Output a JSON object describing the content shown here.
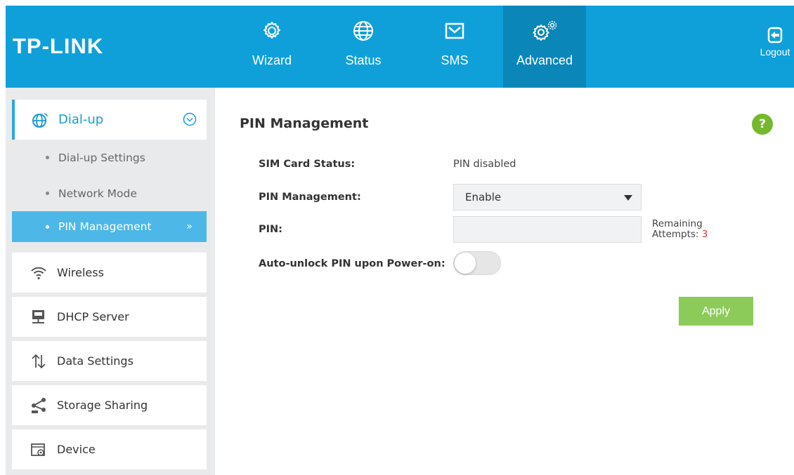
{
  "brand": {
    "logo": "TP-LINK",
    "accent": "#0fa0da",
    "active_tab_bg": "#0b86b8"
  },
  "nav": {
    "items": [
      {
        "label": "Wizard",
        "icon": "gear-icon",
        "active": false
      },
      {
        "label": "Status",
        "icon": "globe-icon",
        "active": false
      },
      {
        "label": "SMS",
        "icon": "envelope-icon",
        "active": false
      },
      {
        "label": "Advanced",
        "icon": "gears-icon",
        "active": true
      }
    ],
    "logout": "Logout"
  },
  "sidebar": {
    "dialup": {
      "label": "Dial-up",
      "icon": "globe-signal-icon",
      "expanded": true
    },
    "sub_items": [
      {
        "label": "Dial-up Settings",
        "active": false
      },
      {
        "label": "Network Mode",
        "active": false
      },
      {
        "label": "PIN Management",
        "active": true
      }
    ],
    "items": [
      {
        "label": "Wireless",
        "icon": "wifi-icon"
      },
      {
        "label": "DHCP Server",
        "icon": "dhcp-server-icon"
      },
      {
        "label": "Data Settings",
        "icon": "up-down-arrows-icon"
      },
      {
        "label": "Storage Sharing",
        "icon": "share-icon"
      },
      {
        "label": "Device",
        "icon": "device-settings-icon"
      }
    ]
  },
  "main": {
    "title": "PIN Management",
    "sim_status": {
      "label": "SIM Card Status:",
      "value": "PIN disabled"
    },
    "pin_management": {
      "label": "PIN Management:",
      "value": "Enable"
    },
    "pin": {
      "label": "PIN:",
      "value": "",
      "remaining_label": "Remaining",
      "attempts_label": "Attempts:",
      "attempts_value": "3"
    },
    "auto_unlock": {
      "label": "Auto-unlock PIN upon Power-on:",
      "enabled": false
    },
    "apply_label": "Apply",
    "help_symbol": "?"
  }
}
